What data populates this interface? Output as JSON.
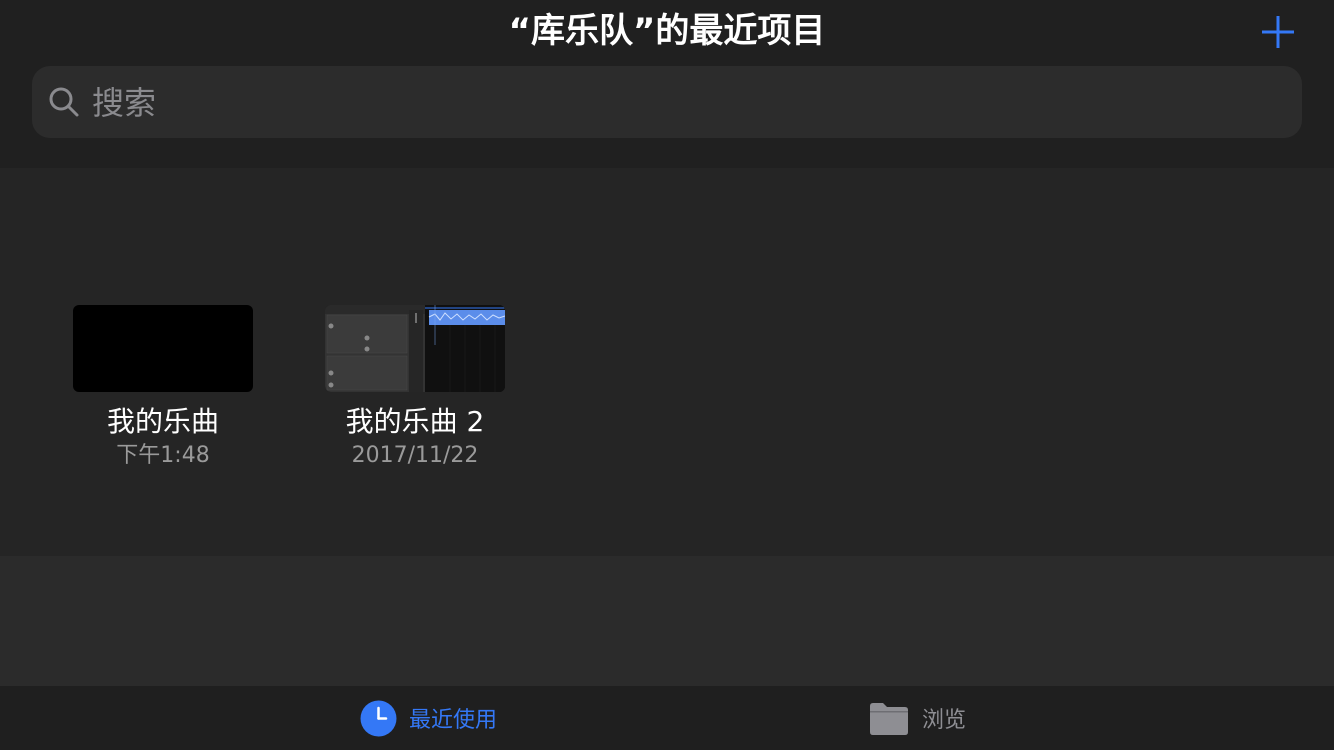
{
  "header": {
    "title": "“库乐队”的最近项目",
    "add_icon": "plus-icon",
    "accent_color": "#3478f6"
  },
  "search": {
    "placeholder": "搜索",
    "icon": "search-icon"
  },
  "projects": [
    {
      "name": "我的乐曲",
      "date": "下午1:48"
    },
    {
      "name": "我的乐曲 2",
      "date": "2017/11/22"
    }
  ],
  "tabbar": {
    "tabs": [
      {
        "label": "最近使用",
        "icon": "clock-icon",
        "active": true
      },
      {
        "label": "浏览",
        "icon": "folder-icon",
        "active": false
      }
    ]
  }
}
